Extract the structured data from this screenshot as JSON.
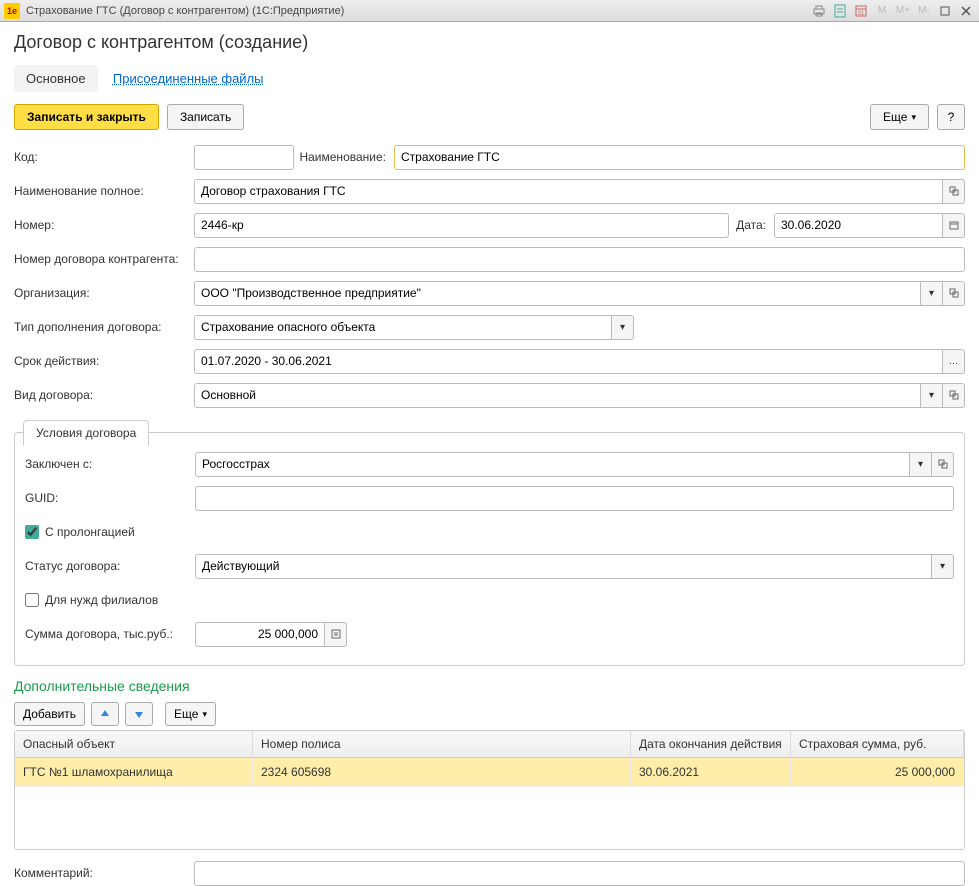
{
  "window": {
    "title": "Страхование ГТС (Договор с контрагентом)  (1С:Предприятие)"
  },
  "header": {
    "title": "Договор с контрагентом (создание)"
  },
  "nav": {
    "main": "Основное",
    "files": "Присоединенные файлы"
  },
  "toolbar": {
    "save_close": "Записать и закрыть",
    "save": "Записать",
    "more": "Еще",
    "help": "?"
  },
  "fields": {
    "code_label": "Код:",
    "code_value": "",
    "name_label": "Наименование:",
    "name_value": "Страхование ГТС",
    "full_name_label": "Наименование полное:",
    "full_name_value": "Договор страхования ГТС",
    "number_label": "Номер:",
    "number_value": "2446-кр",
    "date_label": "Дата:",
    "date_value": "30.06.2020",
    "counterparty_number_label": "Номер договора контрагента:",
    "counterparty_number_value": "",
    "org_label": "Организация:",
    "org_value": "ООО \"Производственное предприятие\"",
    "addition_type_label": "Тип дополнения договора:",
    "addition_type_value": "Страхование опасного объекта",
    "validity_label": "Срок действия:",
    "validity_value": "01.07.2020 - 30.06.2021",
    "contract_kind_label": "Вид договора:",
    "contract_kind_value": "Основной"
  },
  "tab": {
    "title": "Условия договора",
    "concluded_label": "Заключен с:",
    "concluded_value": "Росгосстрах",
    "guid_label": "GUID:",
    "guid_value": "",
    "prolongation": "С пролонгацией",
    "status_label": "Статус договора:",
    "status_value": "Действующий",
    "branches": "Для нужд филиалов",
    "sum_label": "Сумма договора, тыс.руб.:",
    "sum_value": "25 000,000"
  },
  "additional": {
    "title": "Дополнительные сведения",
    "add": "Добавить",
    "more": "Еще",
    "columns": {
      "object": "Опасный объект",
      "policy": "Номер полиса",
      "expiry": "Дата окончания действия",
      "sum": "Страховая сумма, руб."
    },
    "rows": [
      {
        "object": "ГТС №1 шламохранилища",
        "policy": "2324 605698",
        "expiry": "30.06.2021",
        "sum": "25 000,000"
      }
    ]
  },
  "comment": {
    "label": "Комментарий:",
    "value": ""
  }
}
